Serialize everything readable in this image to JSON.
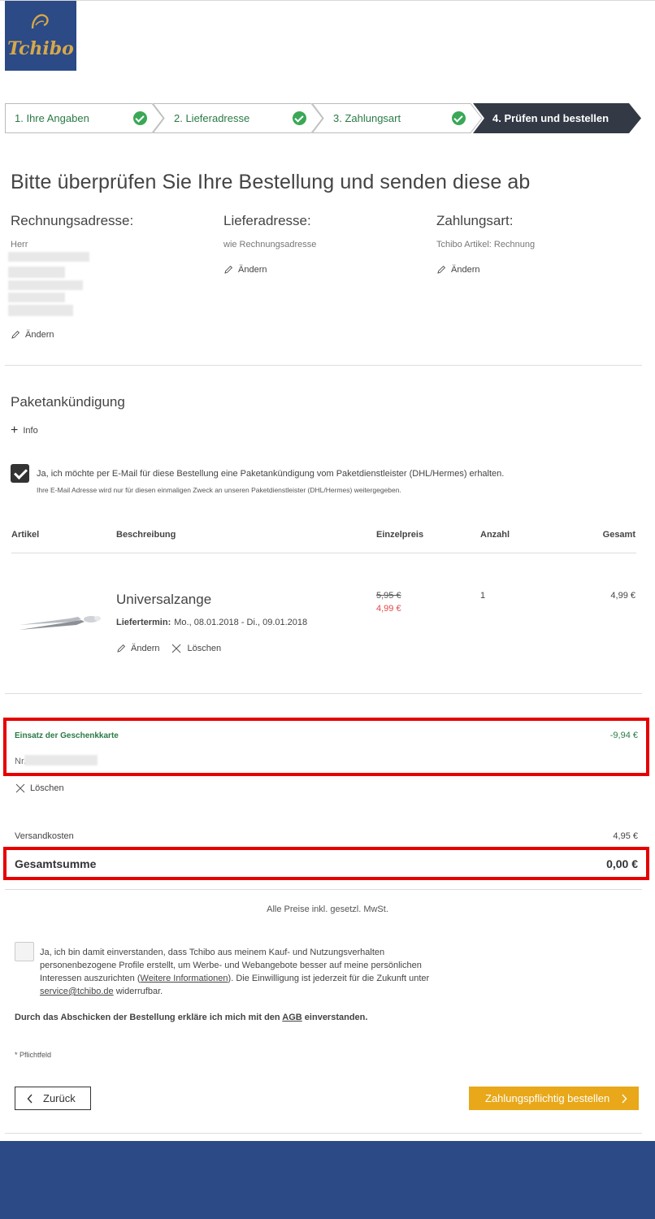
{
  "brand": {
    "logo_text": "Tchibo",
    "color": "#2b4a86"
  },
  "stepper": {
    "steps": [
      {
        "label": "1. Ihre Angaben",
        "done": true
      },
      {
        "label": "2. Lieferadresse",
        "done": true
      },
      {
        "label": "3. Zahlungsart",
        "done": true
      },
      {
        "label": "4. Prüfen und bestellen",
        "active": true
      }
    ]
  },
  "page_title": "Bitte überprüfen Sie Ihre Bestellung und senden diese ab",
  "billing": {
    "title": "Rechnungsadresse:",
    "salutation": "Herr",
    "edit": "Ändern"
  },
  "shipping": {
    "title": "Lieferadresse:",
    "value": "wie Rechnungsadresse",
    "edit": "Ändern"
  },
  "payment": {
    "title": "Zahlungsart:",
    "value": "Tchibo Artikel: Rechnung",
    "edit": "Ändern"
  },
  "parcel": {
    "title": "Paketankündigung",
    "info_link": "Info",
    "consent": "Ja, ich möchte per E-Mail für diese Bestellung eine Paketankündigung vom Paketdienstleister (DHL/Hermes) erhalten.",
    "consent_note": "Ihre E-Mail Adresse wird nur für diesen einmaligen Zweck an unseren Paketdienstleister (DHL/Hermes) weitergegeben."
  },
  "table": {
    "headers": {
      "article": "Artikel",
      "description": "Beschreibung",
      "unit_price": "Einzelpreis",
      "qty": "Anzahl",
      "total": "Gesamt"
    },
    "item": {
      "name": "Universalzange",
      "delivery_label": "Liefertermin:",
      "delivery_value": "Mo., 08.01.2018 - Di., 09.01.2018",
      "old_price": "5,95 €",
      "new_price": "4,99 €",
      "qty": "1",
      "total": "4,99 €",
      "edit": "Ändern",
      "delete": "Löschen"
    }
  },
  "giftcard": {
    "title": "Einsatz der Geschenkkarte",
    "amount": "-9,94 €",
    "nr_label": "Nr.",
    "delete": "Löschen"
  },
  "summary": {
    "shipping_label": "Versandkosten",
    "shipping_value": "4,95 €",
    "total_label": "Gesamtsumme",
    "total_value": "0,00 €"
  },
  "vat_note": "Alle Preise inkl. gesetzl. MwSt.",
  "consent2": {
    "text_a": "Ja, ich bin damit einverstanden, dass Tchibo aus meinem Kauf- und Nutzungsverhalten personenbezogene Profile erstellt, um Werbe- und Webangebote besser auf meine persönlichen Interessen auszurichten (",
    "link": "Weitere Informationen",
    "text_b": "). Die Einwilligung ist jederzeit für die Zukunft unter ",
    "email": "service@tchibo.de",
    "text_c": " widerrufbar."
  },
  "agb": {
    "text_a": "Durch das Abschicken der Bestellung erkläre ich mich mit den ",
    "link": "AGB",
    "text_b": " einverstanden."
  },
  "required_note": "*  Pflichtfeld",
  "buttons": {
    "back": "Zurück",
    "order": "Zahlungspflichtig bestellen"
  },
  "colors": {
    "accent_green": "#2a7a45",
    "check_green": "#3aa856",
    "order_button": "#e8a81a",
    "highlight_red": "#e60000",
    "sale_red": "#e04848"
  }
}
